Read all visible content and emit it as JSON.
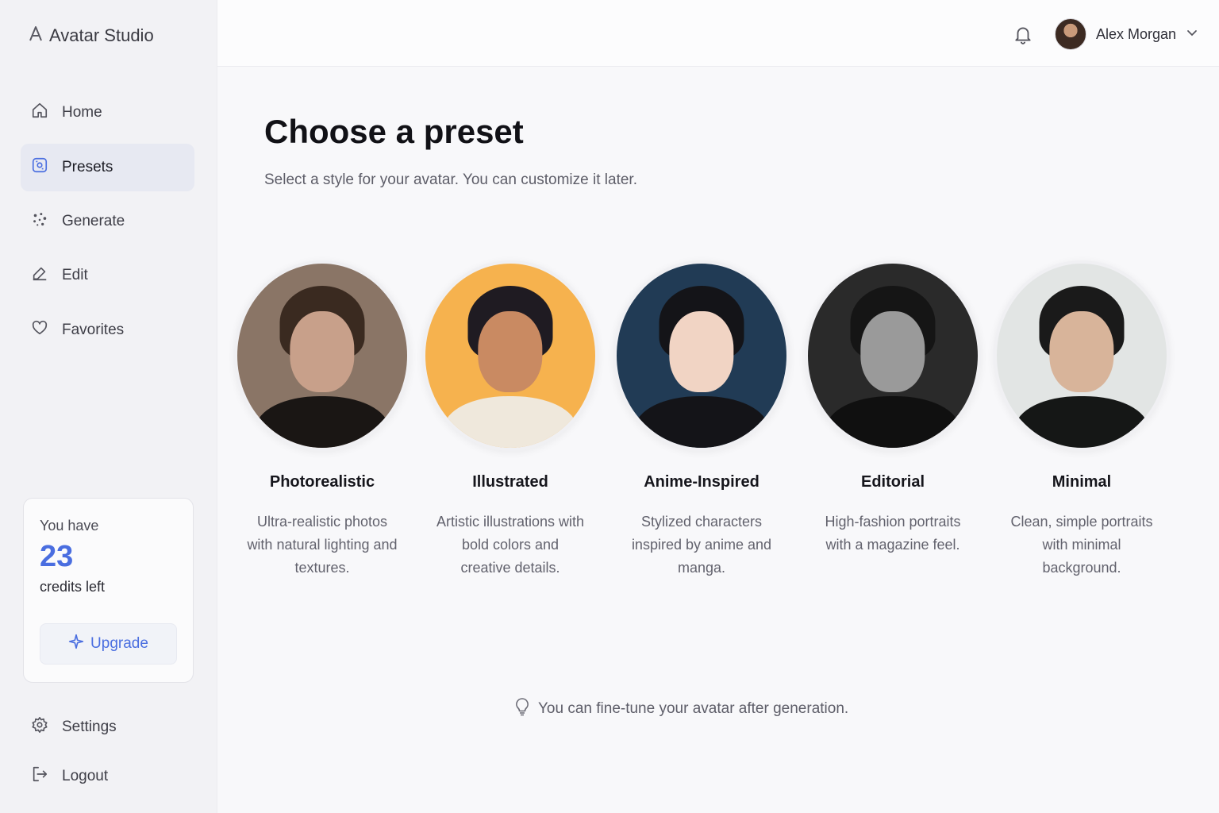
{
  "app": {
    "title": "Avatar Studio"
  },
  "sidebar": {
    "items": [
      {
        "label": "Home",
        "icon": "home-icon"
      },
      {
        "label": "Presets",
        "icon": "presets-icon",
        "active": true
      },
      {
        "label": "Generate",
        "icon": "sparkle-dots-icon"
      },
      {
        "label": "Edit",
        "icon": "pencil-icon"
      },
      {
        "label": "Favorites",
        "icon": "heart-icon"
      }
    ],
    "bottom_items": [
      {
        "label": "Settings",
        "icon": "gear-icon"
      },
      {
        "label": "Logout",
        "icon": "logout-icon"
      }
    ]
  },
  "credits": {
    "prefix": "You have",
    "count": "23",
    "suffix": "credits left",
    "upgrade_label": "Upgrade"
  },
  "header": {
    "user_name": "Alex Morgan"
  },
  "main": {
    "title": "Choose a preset",
    "subtitle": "Select a style for your avatar. You can customize it later.",
    "presets": [
      {
        "name": "Photorealistic",
        "description": "Ultra-realistic photos with natural lighting and textures.",
        "colors": {
          "bg": "#8a7566",
          "skin": "#c8a08a",
          "hair": "#3a2a20",
          "body": "#1a1614"
        }
      },
      {
        "name": "Illustrated",
        "description": "Artistic illustrations with bold colors and creative details.",
        "colors": {
          "bg": "#f6b24e",
          "skin": "#c98a62",
          "hair": "#1f1b22",
          "body": "#efe8dc"
        }
      },
      {
        "name": "Anime-Inspired",
        "description": "Stylized characters inspired by anime and manga.",
        "colors": {
          "bg": "#213b55",
          "skin": "#f1d4c4",
          "hair": "#141418",
          "body": "#141418"
        }
      },
      {
        "name": "Editorial",
        "description": "High-fashion portraits with a magazine feel.",
        "colors": {
          "bg": "#2a2a2a",
          "skin": "#9a9a9a",
          "hair": "#151515",
          "body": "#101010"
        }
      },
      {
        "name": "Minimal",
        "description": "Clean, simple portraits with minimal background.",
        "colors": {
          "bg": "#e2e5e4",
          "skin": "#d8b49a",
          "hair": "#1a1a1a",
          "body": "#151716"
        }
      }
    ],
    "tip": "You can fine-tune your avatar after generation."
  }
}
